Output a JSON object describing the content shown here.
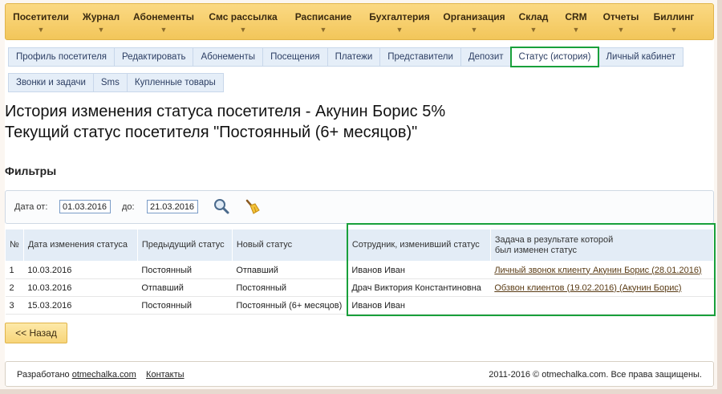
{
  "topmenu": [
    "Посетители",
    "Журнал",
    "Абонементы",
    "Смс рассылка",
    "Расписание",
    "Бухгалтерия",
    "Организация",
    "Склад",
    "CRM",
    "Отчеты",
    "Биллинг"
  ],
  "tabs_row1": [
    {
      "label": "Профиль посетителя"
    },
    {
      "label": "Редактировать"
    },
    {
      "label": "Абонементы"
    },
    {
      "label": "Посещения"
    },
    {
      "label": "Платежи"
    },
    {
      "label": "Представители"
    },
    {
      "label": "Депозит"
    },
    {
      "label": "Статус (история)",
      "active": true
    },
    {
      "label": "Личный кабинет"
    }
  ],
  "tabs_row2": [
    {
      "label": "Звонки и задачи"
    },
    {
      "label": "Sms"
    },
    {
      "label": "Купленные товары"
    }
  ],
  "heading": {
    "line1": "История изменения статуса посетителя - Акунин Борис 5%",
    "line2": "Текущий статус посетителя \"Постоянный (6+ месяцов)\""
  },
  "filters": {
    "title": "Фильтры",
    "date_from_label": "Дата от:",
    "date_from": "01.03.2016",
    "date_to_label": "до:",
    "date_to": "21.03.2016"
  },
  "table": {
    "headers": [
      "№",
      "Дата изменения статуса",
      "Предыдущий статус",
      "Новый статус",
      "Сотрудник, изменивший статус",
      "Задача в результате которой был изменен статус"
    ],
    "rows": [
      [
        "1",
        "10.03.2016",
        "Постоянный",
        "Отпавший",
        "Иванов Иван",
        "Личный звонок клиенту Акунин Борис (28.01.2016)"
      ],
      [
        "2",
        "10.03.2016",
        "Отпавший",
        "Постоянный",
        "Драч Виктория Константиновна",
        "Обзвон клиентов (19.02.2016) (Акунин Борис)"
      ],
      [
        "3",
        "15.03.2016",
        "Постоянный",
        "Постоянный (6+ месяцов)",
        "Иванов Иван",
        ""
      ]
    ]
  },
  "back_label": "<< Назад",
  "footer": {
    "developed": "Разработано",
    "site": "otmechalka.com",
    "contacts": "Контакты",
    "copyright": "2011-2016 © otmechalka.com. Все права защищены."
  },
  "colors": {
    "menu": "#f2c65a",
    "tab": "#e5eef8",
    "highlight": "#19a03b",
    "link": "#5a3b14"
  },
  "icons": [
    "search-icon",
    "broom-icon",
    "chevron-down-icon"
  ]
}
